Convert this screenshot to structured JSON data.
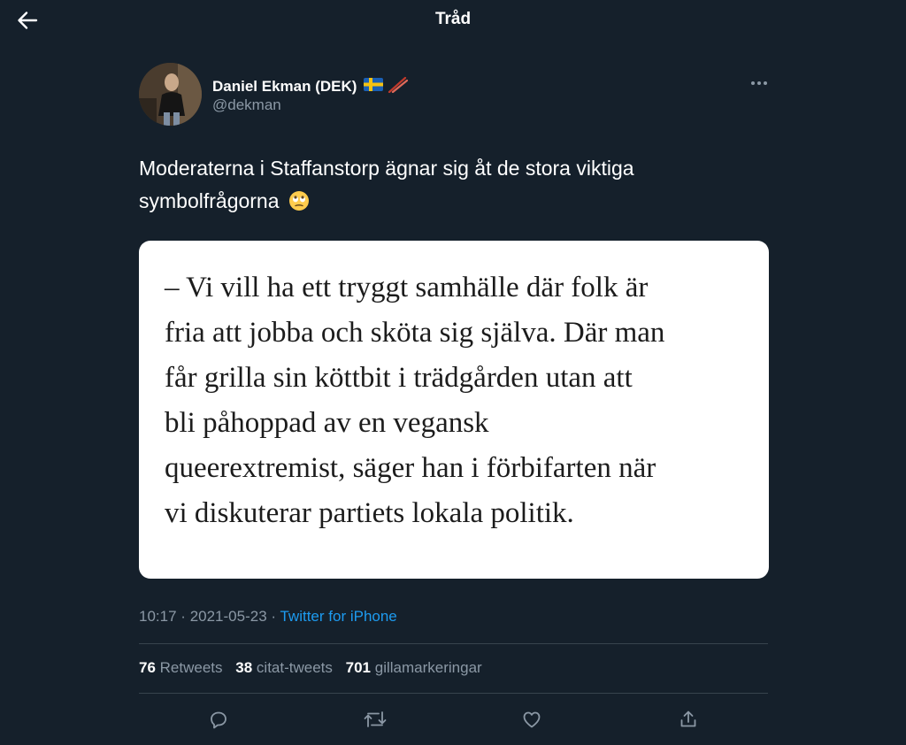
{
  "header": {
    "title": "Tråd",
    "back_icon": "arrow-left-icon"
  },
  "tweet": {
    "author": {
      "name": "Daniel Ekman (DEK)",
      "handle": "@dekman",
      "name_icons": [
        "sweden-flag-icon",
        "chopsticks-icon"
      ]
    },
    "text": "Moderaterna i Staffanstorp ägnar sig åt de stora viktiga symbolfrågorna",
    "text_emoji": "face-with-rolling-eyes-icon",
    "media": {
      "quote_lines": [
        "– Vi vill ha ett tryggt samhälle där folk är",
        "fria att jobba och sköta sig själva. Där man",
        "får grilla sin köttbit i trädgården utan att",
        "bli påhoppad av en vegansk",
        "queerextremist, säger han i förbifarten när",
        "vi diskuterar partiets lokala politik."
      ]
    },
    "time": "10:17",
    "separator": "·",
    "date": "2021-05-23",
    "source": "Twitter for iPhone",
    "stats": {
      "retweets_count": "76",
      "retweets_label": "Retweets",
      "quotes_count": "38",
      "quotes_label": "citat-tweets",
      "likes_count": "701",
      "likes_label": "gillamarkeringar"
    },
    "actions": [
      "reply-icon",
      "retweet-icon",
      "like-icon",
      "share-icon"
    ]
  },
  "colors": {
    "background": "#15202b",
    "text_primary": "#ffffff",
    "text_secondary": "#8b98a5",
    "accent": "#1d9bf0",
    "divider": "#38444d"
  }
}
